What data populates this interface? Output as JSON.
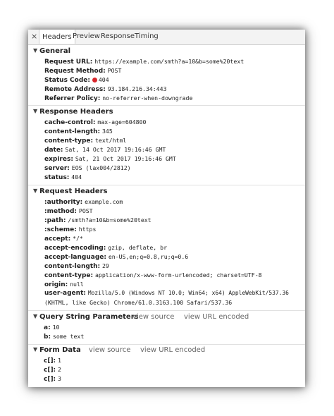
{
  "tabs": {
    "close": "×",
    "items": [
      {
        "label": "Headers"
      },
      {
        "label": "Preview"
      },
      {
        "label": "Response"
      },
      {
        "label": "Timing"
      }
    ]
  },
  "general": {
    "title": "General",
    "request_url": {
      "key": "Request URL:",
      "value": "https://example.com/smth?a=10&b=some%20text"
    },
    "request_method": {
      "key": "Request Method:",
      "value": "POST"
    },
    "status_code": {
      "key": "Status Code:",
      "value": "404",
      "color": "#d8262b"
    },
    "remote_address": {
      "key": "Remote Address:",
      "value": "93.184.216.34:443"
    },
    "referrer_policy": {
      "key": "Referrer Policy:",
      "value": "no-referrer-when-downgrade"
    }
  },
  "response_headers": {
    "title": "Response Headers",
    "rows": [
      {
        "key": "cache-control:",
        "value": "max-age=604800"
      },
      {
        "key": "content-length:",
        "value": "345"
      },
      {
        "key": "content-type:",
        "value": "text/html"
      },
      {
        "key": "date:",
        "value": "Sat, 14 Oct 2017 19:16:46 GMT"
      },
      {
        "key": "expires:",
        "value": "Sat, 21 Oct 2017 19:16:46 GMT"
      },
      {
        "key": "server:",
        "value": "EOS (lax004/2812)"
      },
      {
        "key": "status:",
        "value": "404"
      }
    ]
  },
  "request_headers": {
    "title": "Request Headers",
    "rows": [
      {
        "key": ":authority:",
        "value": "example.com"
      },
      {
        "key": ":method:",
        "value": "POST"
      },
      {
        "key": ":path:",
        "value": "/smth?a=10&b=some%20text"
      },
      {
        "key": ":scheme:",
        "value": "https"
      },
      {
        "key": "accept:",
        "value": "*/*"
      },
      {
        "key": "accept-encoding:",
        "value": "gzip, deflate, br"
      },
      {
        "key": "accept-language:",
        "value": "en-US,en;q=0.8,ru;q=0.6"
      },
      {
        "key": "content-length:",
        "value": "29"
      },
      {
        "key": "content-type:",
        "value": "application/x-www-form-urlencoded; charset=UTF-8"
      },
      {
        "key": "origin:",
        "value": "null"
      },
      {
        "key": "user-agent:",
        "value": "Mozilla/5.0 (Windows NT 10.0; Win64; x64) AppleWebKit/537.36"
      },
      {
        "key": "",
        "value": "(KHTML, like Gecko) Chrome/61.0.3163.100 Safari/537.36"
      }
    ]
  },
  "query_string": {
    "title": "Query String Parameters",
    "view_source": "view source",
    "view_url_encoded": "view URL encoded",
    "rows": [
      {
        "key": "a:",
        "value": "10"
      },
      {
        "key": "b:",
        "value": "some text"
      }
    ]
  },
  "form_data": {
    "title": "Form Data",
    "view_source": "view source",
    "view_url_encoded": "view URL encoded",
    "rows": [
      {
        "key": "c[]:",
        "value": "1"
      },
      {
        "key": "c[]:",
        "value": "2"
      },
      {
        "key": "c[]:",
        "value": "3"
      }
    ]
  }
}
